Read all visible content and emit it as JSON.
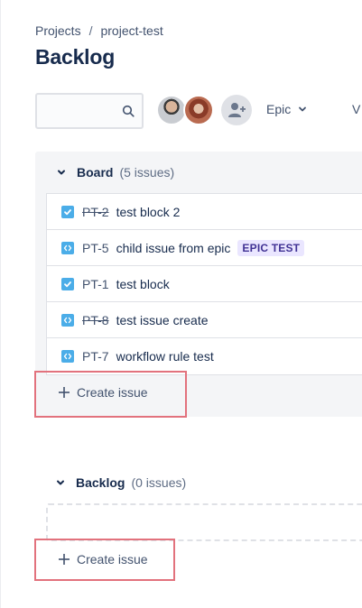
{
  "breadcrumb": {
    "projects": "Projects",
    "separator": "/",
    "project": "project-test"
  },
  "page": {
    "title": "Backlog"
  },
  "toolbar": {
    "search": {
      "value": "",
      "placeholder": ""
    },
    "epic_filter": "Epic",
    "version_filter": "V"
  },
  "board": {
    "name": "Board",
    "count": "(5 issues)",
    "create_label": "Create issue",
    "issues": [
      {
        "type": "task",
        "key": "PT-2",
        "summary": "test block 2",
        "done": true,
        "epic": ""
      },
      {
        "type": "subtask",
        "key": "PT-5",
        "summary": "child issue from epic",
        "done": false,
        "epic": "EPIC TEST"
      },
      {
        "type": "task",
        "key": "PT-1",
        "summary": "test block",
        "done": false,
        "epic": ""
      },
      {
        "type": "subtask",
        "key": "PT-8",
        "summary": "test issue create",
        "done": true,
        "epic": ""
      },
      {
        "type": "subtask",
        "key": "PT-7",
        "summary": "workflow rule test",
        "done": false,
        "epic": ""
      }
    ]
  },
  "backlog": {
    "name": "Backlog",
    "count": "(0 issues)",
    "create_label": "Create issue"
  },
  "colors": {
    "epic_lozenge_bg": "#eae6ff",
    "epic_lozenge_text": "#403294",
    "issue_icon": "#4bade8",
    "highlight": "#e2727d"
  }
}
